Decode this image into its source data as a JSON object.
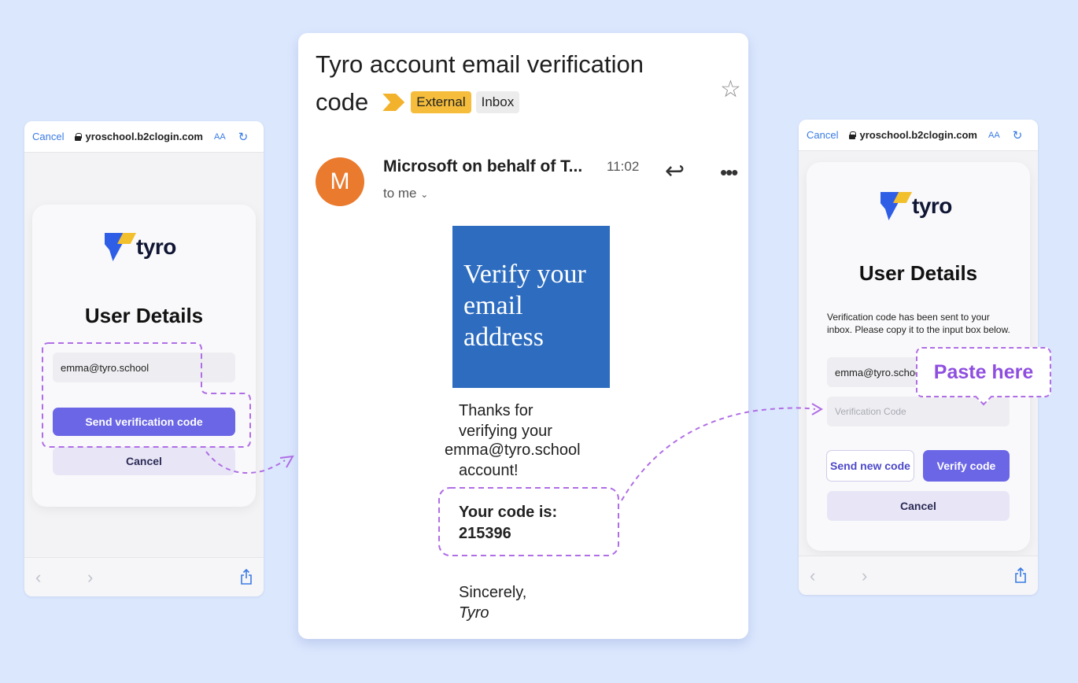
{
  "left_screen": {
    "url_cancel": "Cancel",
    "url": "yroschool.b2clogin.com",
    "url_aa": "AA",
    "logo_text": "tyro",
    "title": "User Details",
    "email_value": "emma@tyro.school",
    "send_button": "Send verification code",
    "cancel_button": "Cancel"
  },
  "email": {
    "subject_line1": "Tyro account email verification",
    "subject_line2": "code",
    "tag_external": "External",
    "tag_inbox": "Inbox",
    "avatar_letter": "M",
    "sender": "Microsoft on behalf of T...",
    "time": "11:02",
    "to": "to me",
    "banner_lines": [
      "Verify your",
      "email",
      "address"
    ],
    "body_line1": "Thanks for",
    "body_line2": "verifying your",
    "body_email": "emma@tyro.school",
    "body_line3": "account!",
    "code_label": "Your code is:",
    "code_value": "215396",
    "sign_off": "Sincerely,",
    "signature": "Tyro"
  },
  "right_screen": {
    "url_cancel": "Cancel",
    "url": "yroschool.b2clogin.com",
    "url_aa": "AA",
    "logo_text": "tyro",
    "title": "User Details",
    "helper_text": "Verification code has been sent to your inbox. Please copy it to the input box below.",
    "email_value": "emma@tyro.school",
    "code_placeholder": "Verification Code",
    "send_new_button": "Send new code",
    "verify_button": "Verify code",
    "cancel_button": "Cancel"
  },
  "annotation": {
    "paste_tip": "Paste here"
  },
  "colors": {
    "background": "#dbe7fd",
    "primary_button": "#6b66e6",
    "annotation": "#b06ee6",
    "banner": "#2d6cbf",
    "tag_external": "#f5bd3b"
  }
}
